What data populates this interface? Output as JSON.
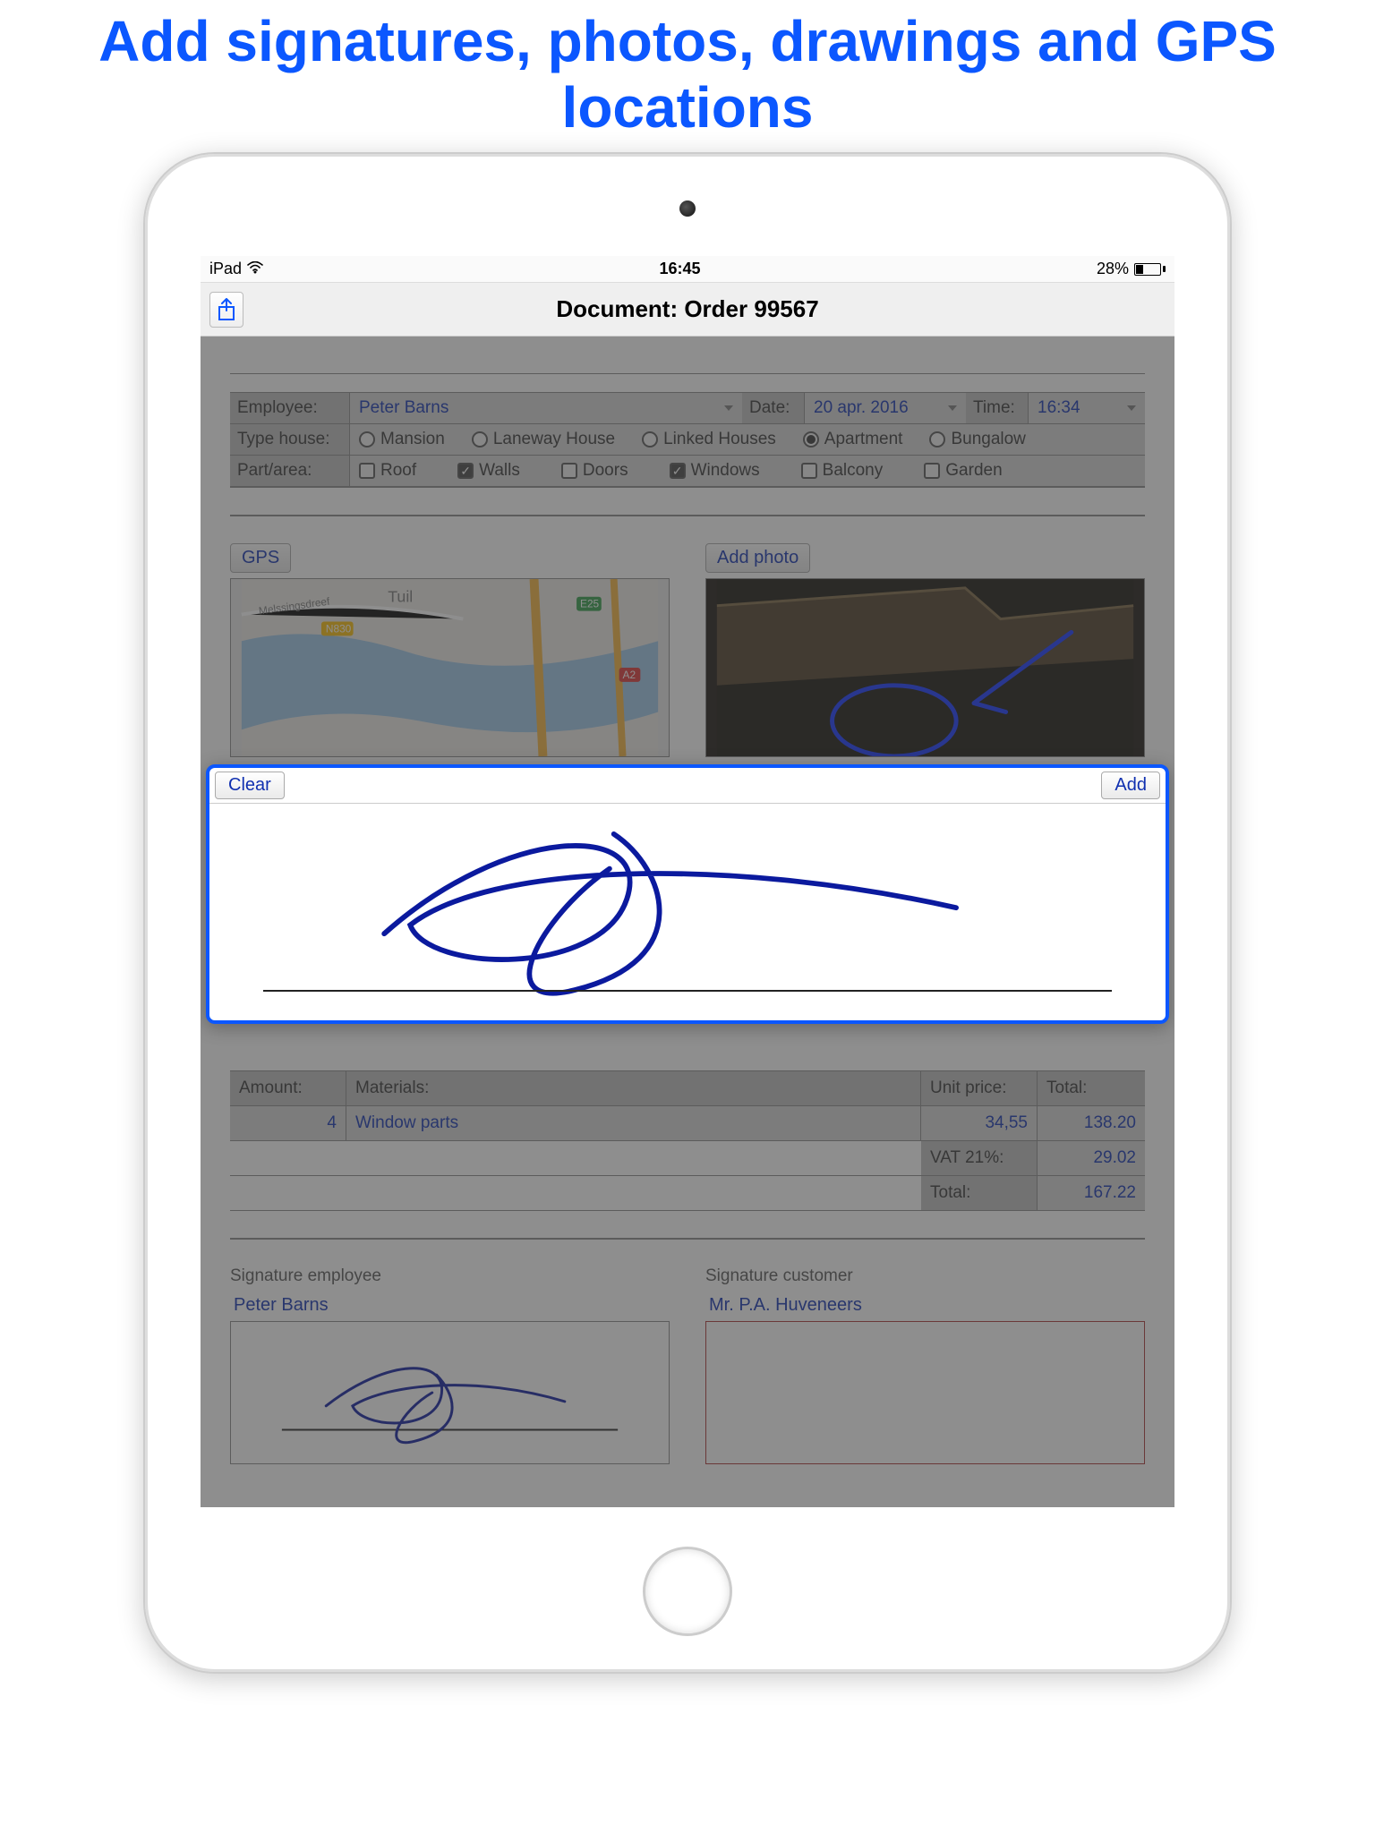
{
  "banner": {
    "title": "Add signatures, photos, drawings and GPS locations"
  },
  "statusbar": {
    "device": "iPad",
    "time": "16:45",
    "battery_pct": "28%"
  },
  "navbar": {
    "title": "Document: Order 99567"
  },
  "form": {
    "employee_label": "Employee:",
    "employee_value": "Peter Barns",
    "date_label": "Date:",
    "date_value": "20 apr. 2016",
    "time_label": "Time:",
    "time_value": "16:34",
    "type_label": "Type house:",
    "type_options": [
      {
        "label": "Mansion",
        "selected": false
      },
      {
        "label": "Laneway House",
        "selected": false
      },
      {
        "label": "Linked Houses",
        "selected": false
      },
      {
        "label": "Apartment",
        "selected": true
      },
      {
        "label": "Bungalow",
        "selected": false
      }
    ],
    "part_label": "Part/area:",
    "part_options": [
      {
        "label": "Roof",
        "selected": false
      },
      {
        "label": "Walls",
        "selected": true
      },
      {
        "label": "Doors",
        "selected": false
      },
      {
        "label": "Windows",
        "selected": true
      },
      {
        "label": "Balcony",
        "selected": false
      },
      {
        "label": "Garden",
        "selected": false
      }
    ]
  },
  "sections": {
    "gps_button": "GPS",
    "add_photo_button": "Add photo",
    "map_labels": {
      "tuil": "Tuil",
      "street": "Melssingsdreef",
      "road1": "N830",
      "road2": "E25",
      "road3": "A2"
    }
  },
  "materials": {
    "headers": {
      "amount": "Amount:",
      "materials": "Materials:",
      "unit": "Unit price:",
      "total": "Total:"
    },
    "rows": [
      {
        "amount": "4",
        "material": "Window parts",
        "unit": "34,55",
        "total": "138.20"
      }
    ],
    "vat_label": "VAT 21%:",
    "vat_value": "29.02",
    "total_label": "Total:",
    "total_value": "167.22"
  },
  "signatures": {
    "employee_title": "Signature employee",
    "employee_name": "Peter Barns",
    "customer_title": "Signature customer",
    "customer_name": "Mr. P.A. Huveneers"
  },
  "popup": {
    "clear": "Clear",
    "add": "Add"
  }
}
